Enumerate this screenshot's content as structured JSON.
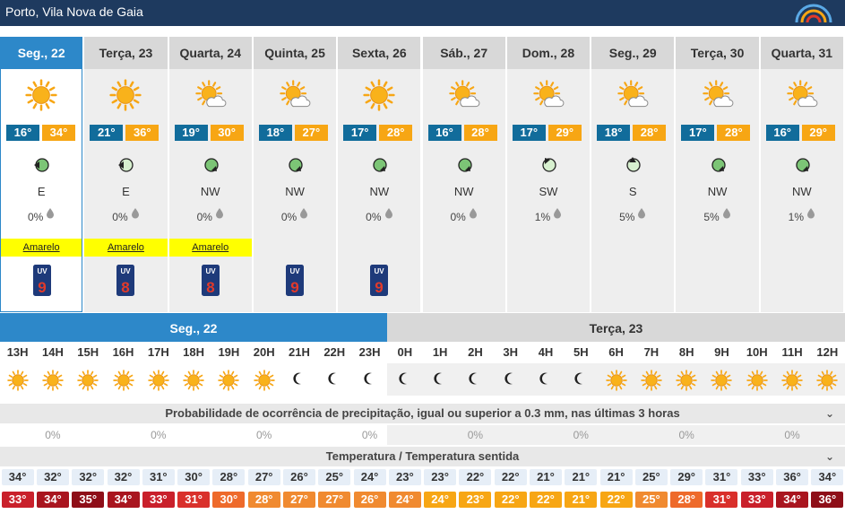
{
  "location": "Porto, Vila Nova de Gaia",
  "days": [
    {
      "label": "Seg., 22",
      "tmin": "16°",
      "tmax": "34°",
      "weather": "sun",
      "wind_dir": "E",
      "wind_icon": "wind-east",
      "precip": "0%",
      "warning": "Amarelo",
      "uv": "9"
    },
    {
      "label": "Terça, 23",
      "tmin": "21°",
      "tmax": "36°",
      "weather": "sun",
      "wind_dir": "E",
      "wind_icon": "wind-east",
      "precip": "0%",
      "warning": "Amarelo",
      "uv": "8"
    },
    {
      "label": "Quarta, 24",
      "tmin": "19°",
      "tmax": "30°",
      "weather": "sun-cloud",
      "wind_dir": "NW",
      "wind_icon": "wind-nw",
      "precip": "0%",
      "warning": "Amarelo",
      "uv": "8"
    },
    {
      "label": "Quinta, 25",
      "tmin": "18°",
      "tmax": "27°",
      "weather": "sun-cloud",
      "wind_dir": "NW",
      "wind_icon": "wind-nw",
      "precip": "0%",
      "warning": "",
      "uv": "9"
    },
    {
      "label": "Sexta, 26",
      "tmin": "17°",
      "tmax": "28°",
      "weather": "sun",
      "wind_dir": "NW",
      "wind_icon": "wind-nw",
      "precip": "0%",
      "warning": "",
      "uv": "9"
    },
    {
      "label": "Sáb., 27",
      "tmin": "16°",
      "tmax": "28°",
      "weather": "sun-cloud",
      "wind_dir": "NW",
      "wind_icon": "wind-nw",
      "precip": "0%",
      "warning": "",
      "uv": ""
    },
    {
      "label": "Dom., 28",
      "tmin": "17°",
      "tmax": "29°",
      "weather": "sun-cloud",
      "wind_dir": "SW",
      "wind_icon": "wind-sw",
      "precip": "1%",
      "warning": "",
      "uv": ""
    },
    {
      "label": "Seg., 29",
      "tmin": "18°",
      "tmax": "28°",
      "weather": "sun-cloud",
      "wind_dir": "S",
      "wind_icon": "wind-south",
      "precip": "5%",
      "warning": "",
      "uv": ""
    },
    {
      "label": "Terça, 30",
      "tmin": "17°",
      "tmax": "28°",
      "weather": "sun-cloud",
      "wind_dir": "NW",
      "wind_icon": "wind-nw",
      "precip": "5%",
      "warning": "",
      "uv": ""
    },
    {
      "label": "Quarta, 31",
      "tmin": "16°",
      "tmax": "29°",
      "weather": "sun-cloud",
      "wind_dir": "NW",
      "wind_icon": "wind-nw",
      "precip": "1%",
      "warning": "",
      "uv": ""
    }
  ],
  "hourly": {
    "day1_label": "Seg., 22",
    "day2_label": "Terça, 23",
    "hours": [
      "13H",
      "14H",
      "15H",
      "16H",
      "17H",
      "18H",
      "19H",
      "20H",
      "21H",
      "22H",
      "23H",
      "0H",
      "1H",
      "2H",
      "3H",
      "4H",
      "5H",
      "6H",
      "7H",
      "8H",
      "9H",
      "10H",
      "11H",
      "12H"
    ],
    "icons": [
      "sun",
      "sun",
      "sun",
      "sun",
      "sun",
      "sun",
      "sun",
      "sun",
      "moon",
      "moon",
      "moon",
      "moon",
      "moon",
      "moon",
      "moon",
      "moon",
      "moon",
      "sun",
      "sun",
      "sun",
      "sun",
      "sun",
      "sun",
      "sun"
    ],
    "precip_title": "Probabilidade de ocorrência de precipitação, igual ou superior a 0.3 mm, nas últimas 3 horas",
    "precip": [
      "0%",
      "0%",
      "0%",
      "0%",
      "0%",
      "0%",
      "0%",
      "0%"
    ],
    "temp_title": "Temperatura / Temperatura sentida",
    "temps": [
      "34°",
      "32°",
      "32°",
      "32°",
      "31°",
      "30°",
      "28°",
      "27°",
      "26°",
      "25°",
      "24°",
      "23°",
      "23°",
      "22°",
      "22°",
      "21°",
      "21°",
      "21°",
      "25°",
      "29°",
      "31°",
      "33°",
      "36°",
      "34°"
    ],
    "feels": [
      "33°",
      "34°",
      "35°",
      "34°",
      "33°",
      "31°",
      "30°",
      "28°",
      "27°",
      "27°",
      "26°",
      "24°",
      "24°",
      "23°",
      "22°",
      "22°",
      "21°",
      "22°",
      "25°",
      "28°",
      "31°",
      "33°",
      "34°",
      "36°"
    ],
    "feel_colors": [
      "#c9202b",
      "#a9151f",
      "#8e0e18",
      "#a9151f",
      "#c9202b",
      "#d9302b",
      "#ee6a2b",
      "#f08a30",
      "#f08a30",
      "#f08a30",
      "#f08a30",
      "#f08a30",
      "#f7a614",
      "#f7a614",
      "#f7a614",
      "#f7a614",
      "#f7a614",
      "#f7a614",
      "#f08a30",
      "#ee6a2b",
      "#d9302b",
      "#c9202b",
      "#a9151f",
      "#8e0e18"
    ]
  },
  "colors": {
    "accent": "#2d88c9",
    "header_bg": "#1e3a5f",
    "tmin_bg": "#116c9b",
    "tmax_bg": "#f7a614",
    "warning": "#ffff00"
  }
}
